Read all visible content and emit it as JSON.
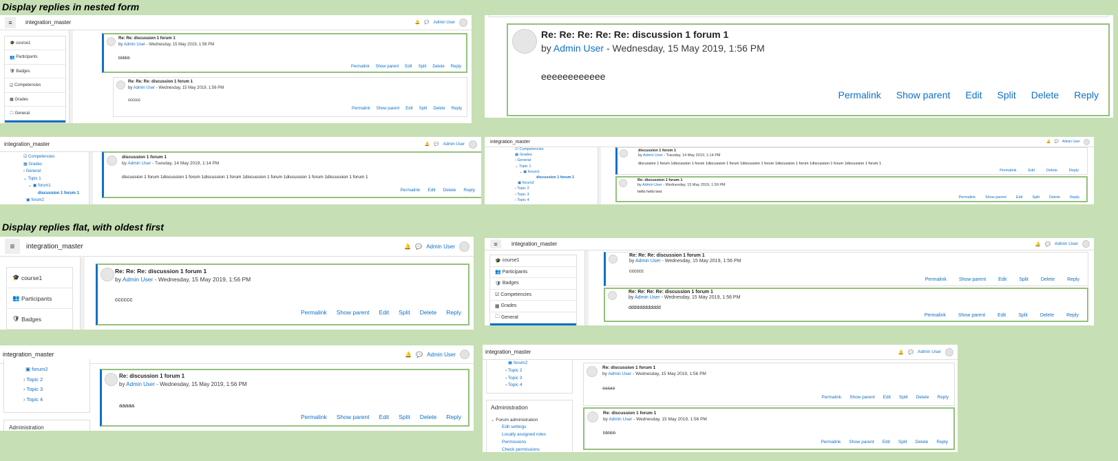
{
  "headings": {
    "nested": "Display replies in nested form",
    "flat": "Display replies flat, with oldest first"
  },
  "site": "integration_master",
  "user": "Admin User",
  "nav_items": [
    "course1",
    "Participants",
    "Badges",
    "Competencies",
    "Grades",
    "General"
  ],
  "tree_a": [
    "Competencies",
    "Grades",
    "General",
    "Topic 1",
    "forum1",
    "discussion 1 forum 1",
    "forum2"
  ],
  "tree_b": [
    "forum2",
    "Topic 2",
    "Topic 3",
    "Topic 4"
  ],
  "admin": {
    "title": "Administration",
    "forum_admin": "Forum administration",
    "links": [
      "Edit settings",
      "Locally assigned roles",
      "Permissions",
      "Check permissions"
    ]
  },
  "cmd": {
    "permalink": "Permalink",
    "show_parent": "Show parent",
    "edit": "Edit",
    "split": "Split",
    "delete": "Delete",
    "reply": "Reply"
  },
  "posts": {
    "p1": {
      "title": "Re: Re: discussion 1 forum 1",
      "date": "Wednesday, 15 May 2019, 1:56 PM",
      "msg": "bbbbb"
    },
    "p2": {
      "title": "Re: Re: Re: discussion 1 forum 1",
      "date": "Wednesday, 15 May 2019, 1:56 PM",
      "msg": "cccccc"
    },
    "p3": {
      "title": "Re: Re: Re: Re: Re: discussion 1 forum 1",
      "date": "Wednesday, 15 May 2019, 1:56 PM",
      "msg": "eeeeeeeeeeee"
    },
    "p4": {
      "title": "discussion 1 forum 1",
      "date": "Tuesday, 14 May 2019, 1:14 PM",
      "msg": "discussion 1 forum 1discussion 1 forum 1discussion 1 forum 1discussion 1 forum 1discussion 1 forum 1discussion 1 forum 1"
    },
    "p5": {
      "title": "discussion 1 forum 1",
      "date": "Tuesday, 14 May 2019, 1:14 PM",
      "msg": "discussion 1 forum 1discussion 1 forum 1discussion 1 forum 1discussion 1 forum 1discussion 1 forum 1discussion 1 forum 1discussion 1 forum 1"
    },
    "p6": {
      "title": "Re: discussion 1 forum 1",
      "date": "Wednesday, 15 May 2019, 1:59 PM",
      "msg": "hello hello test"
    },
    "p7": {
      "title": "Re: Re: Re: discussion 1 forum 1",
      "date": "Wednesday, 15 May 2019, 1:56 PM",
      "msg": "cccccc"
    },
    "p8": {
      "title": "Re: Re: Re: discussion 1 forum 1",
      "date": "Wednesday, 15 May 2019, 1:56 PM",
      "msg": "cccccc"
    },
    "p9": {
      "title": "Re: Re: Re: Re: discussion 1 forum 1",
      "date": "Wednesday, 15 May 2019, 1:56 PM",
      "msg": "dddddddddddd"
    },
    "p10": {
      "title": "Re: discussion 1 forum 1",
      "date": "Wednesday, 15 May 2019, 1:56 PM",
      "msg": "aaaaa"
    },
    "p11": {
      "title": "Re: discussion 1 forum 1",
      "date": "Wednesday, 15 May 2019, 1:56 PM",
      "msg": "aaaaa"
    },
    "p12": {
      "title": "Re: discussion 1 forum 1",
      "date": "Wednesday, 15 May 2019, 1:56 PM",
      "msg": "bbbbb"
    }
  },
  "by": "by",
  "dash": " - "
}
